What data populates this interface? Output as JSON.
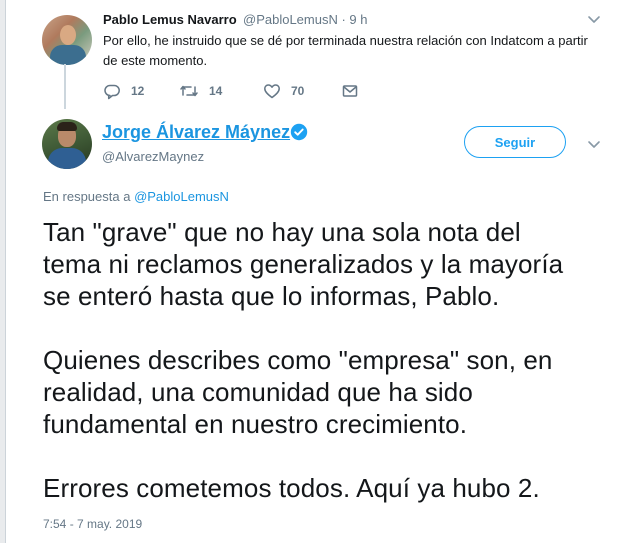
{
  "parent_tweet": {
    "author_name": "Pablo Lemus Navarro",
    "handle_time": "@PabloLemusN · 9 h",
    "text": "Por ello, he instruido que se dé por terminada nuestra relación con Indatcom a partir de este momento.",
    "counts": {
      "replies": "12",
      "retweets": "14",
      "likes": "70"
    },
    "icons": [
      "reply-icon",
      "retweet-icon",
      "heart-icon",
      "direct-message-icon",
      "chevron-down-icon"
    ]
  },
  "main_tweet": {
    "author_name": "Jorge Álvarez Máynez",
    "handle": "@AlvarezMaynez",
    "follow_label": "Seguir",
    "reply_prefix": "En respuesta a ",
    "reply_to": "@PabloLemusN",
    "paragraphs": [
      "Tan \"grave\" que no hay una sola nota del\ntema ni reclamos generalizados y la mayoría\nse enteró hasta que lo informas, Pablo.",
      "Quienes describes como \"empresa\" son, en\nrealidad, una comunidad que ha sido\nfundamental en nuestro crecimiento.",
      "Errores cometemos todos. Aquí ya hubo 2."
    ],
    "timestamp": "7:54 - 7 may. 2019",
    "icons": [
      "verified-icon",
      "chevron-down-icon"
    ]
  },
  "colors": {
    "link": "#1b95e0",
    "follow_accent": "#1da1f2",
    "secondary_text": "#657786",
    "thread_line": "#ccd6dd"
  }
}
